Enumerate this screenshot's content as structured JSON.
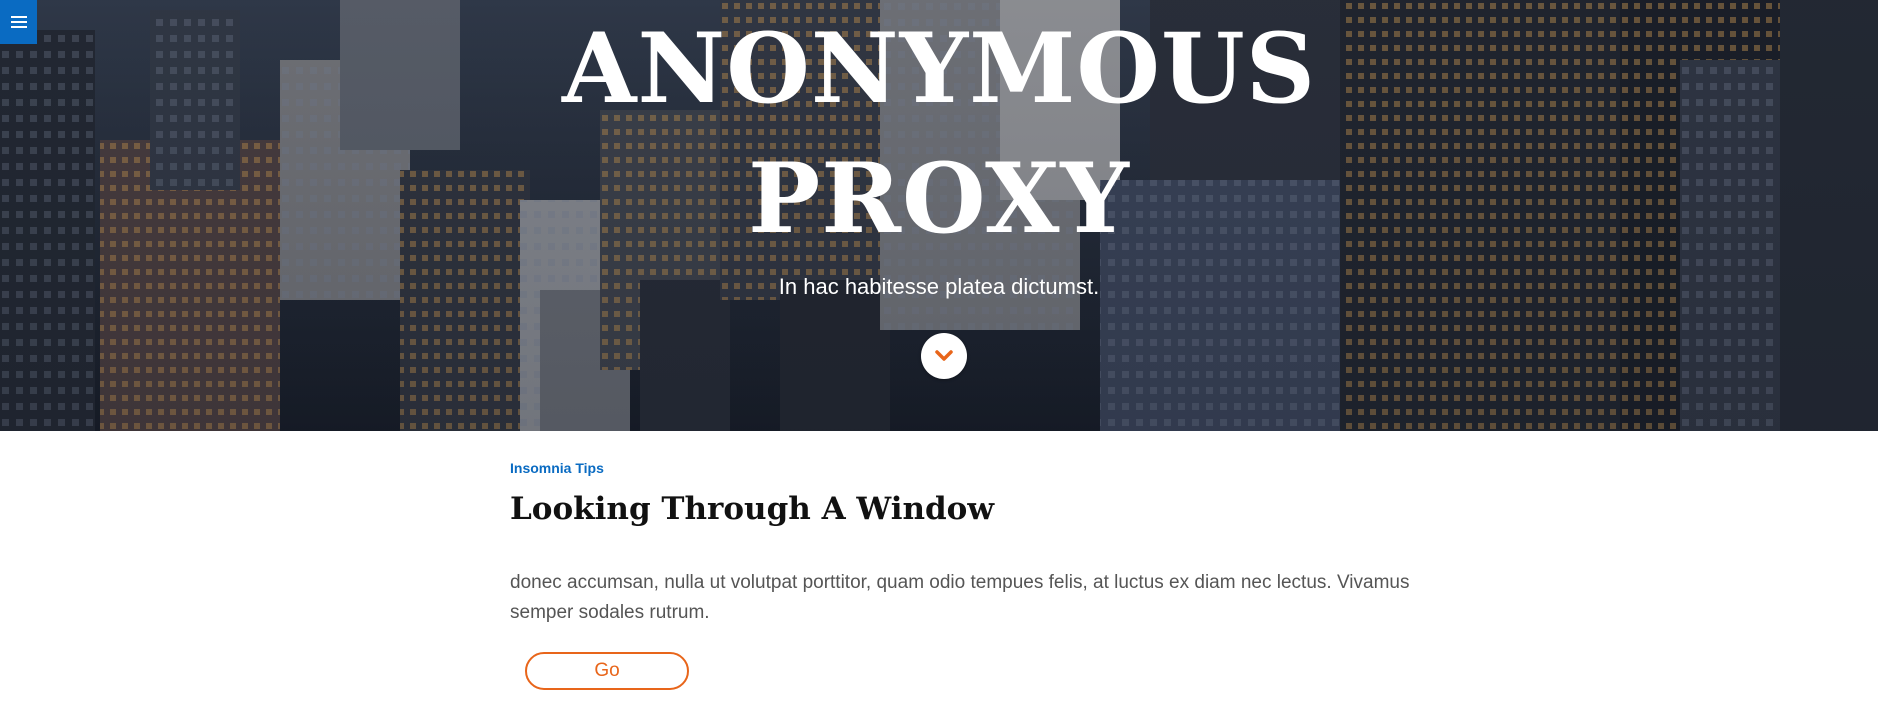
{
  "hero": {
    "title_line1": "ANONYMOUS",
    "title_line2": "PROXY",
    "subtitle": "In hac habitesse platea dictumst."
  },
  "icons": {
    "menu": "hamburger-menu-icon",
    "scroll": "chevron-down-icon"
  },
  "post": {
    "category": "Insomnia Tips",
    "title": "Looking Through A Window",
    "excerpt": "donec accumsan, nulla ut volutpat porttitor, quam odio tempues felis, at luctus ex diam nec lectus. Vivamus semper sodales rutrum.",
    "button_label": "Go"
  },
  "colors": {
    "accent_blue": "#0a6bc2",
    "accent_orange": "#e8651a"
  }
}
